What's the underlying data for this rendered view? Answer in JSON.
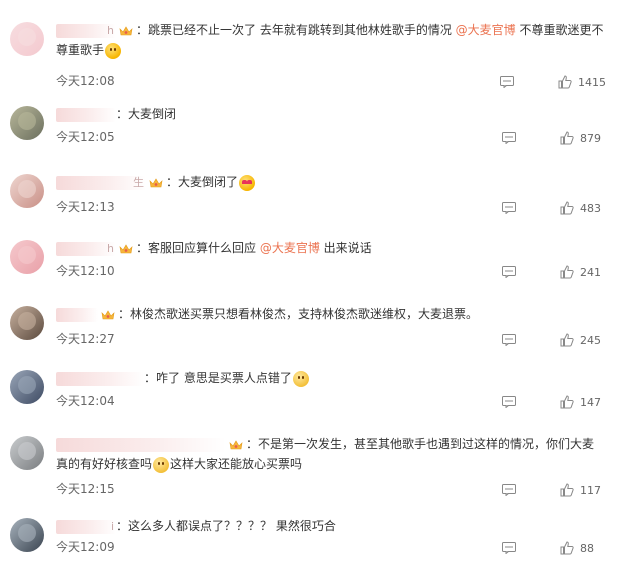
{
  "comments": [
    {
      "name_tail": "h",
      "badge": true,
      "sep": "：",
      "parts": [
        {
          "t": "text",
          "v": "跳票已经不止一次了 去年就有跳转到其他林姓歌手的情况 "
        },
        {
          "t": "mention",
          "v": "@大麦官博"
        },
        {
          "t": "text",
          "v": " 不尊重歌迷更不尊重歌手"
        },
        {
          "t": "emoji",
          "v": "shy"
        }
      ],
      "time": "今天12:08",
      "likes": "1415"
    },
    {
      "name_tail": "",
      "badge": false,
      "sep": "：",
      "parts": [
        {
          "t": "text",
          "v": "大麦倒闭"
        }
      ],
      "time": "今天12:05",
      "likes": "879"
    },
    {
      "name_tail": "生",
      "badge": true,
      "sep": "：",
      "parts": [
        {
          "t": "text",
          "v": "大麦倒闭了"
        },
        {
          "t": "emoji",
          "v": "heart"
        }
      ],
      "time": "今天12:13",
      "likes": "483"
    },
    {
      "name_tail": "h",
      "badge": true,
      "sep": "：",
      "parts": [
        {
          "t": "text",
          "v": "客服回应算什么回应 "
        },
        {
          "t": "mention",
          "v": "@大麦官博"
        },
        {
          "t": "text",
          "v": " 出来说话"
        }
      ],
      "time": "今天12:10",
      "likes": "241"
    },
    {
      "name_tail": "",
      "badge": true,
      "sep": "：",
      "parts": [
        {
          "t": "text",
          "v": "林俊杰歌迷买票只想看林俊杰，支持林俊杰歌迷维权，大麦退票。"
        }
      ],
      "time": "今天12:27",
      "likes": "245"
    },
    {
      "name_tail": "",
      "badge": false,
      "sep": "：",
      "parts": [
        {
          "t": "text",
          "v": "咋了 意思是买票人点错了"
        },
        {
          "t": "emoji",
          "v": "think"
        }
      ],
      "time": "今天12:04",
      "likes": "147"
    },
    {
      "name_tail": "",
      "badge": true,
      "sep": "：",
      "parts": [
        {
          "t": "text",
          "v": "不是第一次发生，甚至其他歌手也遇到过这样的情况，你们大麦真的有好好核查吗"
        },
        {
          "t": "emoji",
          "v": "think"
        },
        {
          "t": "text",
          "v": "这样大家还能放心买票吗"
        }
      ],
      "time": "今天12:15",
      "likes": "117"
    },
    {
      "name_tail": "i",
      "badge": false,
      "sep": "：",
      "parts": [
        {
          "t": "text",
          "v": "这么多人都误点了？？？？ 果然很巧合"
        }
      ],
      "time": "今天12:09",
      "likes": "88"
    }
  ],
  "colors": {
    "mention": "#eb7350",
    "text": "#333333",
    "meta": "#666666"
  }
}
